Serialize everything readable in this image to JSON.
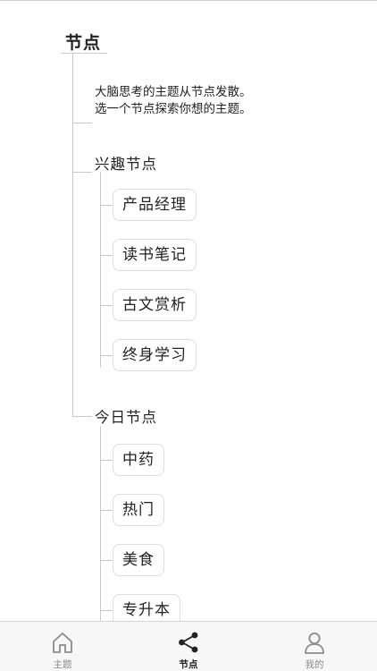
{
  "header": {
    "title": "节点"
  },
  "intro": {
    "line1": "大脑思考的主题从节点发散。",
    "line2": "选一个节点探索你想的主题。"
  },
  "sections": [
    {
      "title": "兴趣节点",
      "nodes": [
        "产品经理",
        "读书笔记",
        "古文赏析",
        "终身学习"
      ]
    },
    {
      "title": "今日节点",
      "nodes": [
        "中药",
        "热门",
        "美食",
        "专升本"
      ]
    }
  ],
  "tabbar": {
    "tabs": [
      {
        "label": "主题",
        "icon": "home-icon",
        "active": false
      },
      {
        "label": "节点",
        "icon": "share-nodes-icon",
        "active": true
      },
      {
        "label": "我的",
        "icon": "user-icon",
        "active": false
      }
    ]
  },
  "colors": {
    "active": "#222222",
    "inactive": "#8a8a8a",
    "line": "#c9c9c9"
  }
}
